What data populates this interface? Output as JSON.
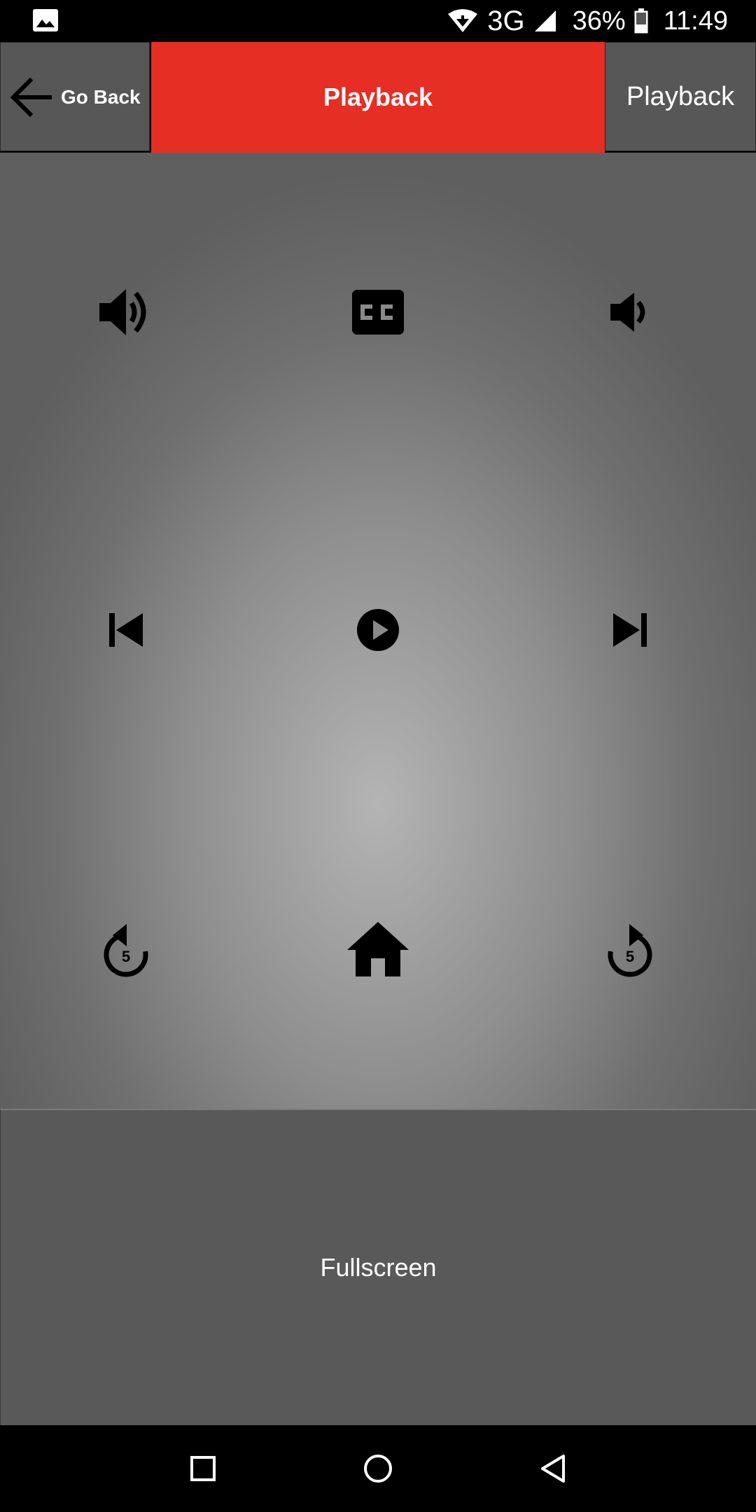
{
  "status_bar": {
    "network": "3G",
    "battery": "36%",
    "time": "11:49",
    "icons": [
      "image-icon",
      "wifi-icon",
      "signal-icon",
      "battery-icon"
    ]
  },
  "header": {
    "back_label": "Go Back",
    "title": "Playback",
    "right_tab": "Playback",
    "accent_color": "#e62e24"
  },
  "controls": {
    "rows": [
      [
        "volume-up-icon",
        "closed-captions-icon",
        "volume-down-icon"
      ],
      [
        "skip-previous-icon",
        "play-icon",
        "skip-next-icon"
      ],
      [
        "replay-5-icon",
        "home-icon",
        "forward-5-icon"
      ]
    ],
    "replay_seconds": "5",
    "forward_seconds": "5"
  },
  "fullscreen_label": "Fullscreen",
  "nav_bar": {
    "icons": [
      "recents-icon",
      "home-nav-icon",
      "back-nav-icon"
    ]
  }
}
